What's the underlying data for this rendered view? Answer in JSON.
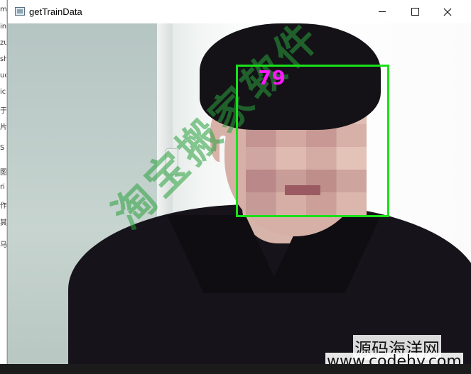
{
  "window": {
    "title": "getTrainData",
    "controls": {
      "minimize": "minimize",
      "maximize": "maximize",
      "close": "close"
    }
  },
  "background_window": {
    "visible_chars": [
      "m",
      "in",
      "zu",
      "sh",
      "ud",
      "ic",
      "于",
      "片",
      "S",
      "图",
      "ri",
      "作",
      "其",
      "马"
    ]
  },
  "detection": {
    "score": "79",
    "box_color": "#19e019",
    "score_color": "#ff19ff"
  },
  "watermarks": {
    "overlay_text": "淘宝搬家软件",
    "site_name": "源码海洋网",
    "site_url": "www.codehy.com"
  }
}
